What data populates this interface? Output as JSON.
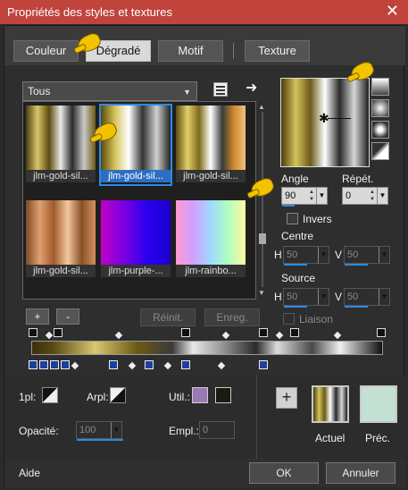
{
  "window": {
    "title": "Propriétés des styles et textures"
  },
  "tabs": [
    {
      "label": "Couleur"
    },
    {
      "label": "Dégradé"
    },
    {
      "label": "Motif"
    },
    {
      "label": "Texture"
    }
  ],
  "gallery": {
    "category": "Tous",
    "items": [
      {
        "label": "jlm-gold-sil..."
      },
      {
        "label": "jlm-gold-sil..."
      },
      {
        "label": "jlm-gold-sil..."
      },
      {
        "label": "jlm-gold-sil..."
      },
      {
        "label": "jlm-purple-..."
      },
      {
        "label": "jlm-rainbo..."
      }
    ],
    "add_label": "+",
    "remove_label": "-",
    "reset_label": "Réinit.",
    "save_label": "Enreg."
  },
  "controls": {
    "angle_label": "Angle",
    "angle_value": "90",
    "repeat_label": "Répét.",
    "repeat_value": "0",
    "invert_label": "Invers",
    "center_label": "Centre",
    "center_h_label": "H",
    "center_h": "50",
    "center_v_label": "V",
    "center_v": "50",
    "source_label": "Source",
    "source_h_label": "H",
    "source_h": "50",
    "source_v_label": "V",
    "source_v": "50",
    "link_label": "Liaison"
  },
  "bottom": {
    "fg_label": "1pl:",
    "bg_label": "Arpl:",
    "use_label": "Util.:",
    "opacity_label": "Opacité:",
    "opacity_value": "100",
    "location_label": "Empl.:",
    "location_value": "0",
    "add_label": "+",
    "current_label": "Actuel",
    "previous_label": "Préc."
  },
  "footer": {
    "help_label": "Aide",
    "ok_label": "OK",
    "cancel_label": "Annuler"
  },
  "colors": {
    "title_bar": "#c0443c",
    "accent": "#2d8ae6",
    "previous_swatch": "#c4e0d2"
  }
}
